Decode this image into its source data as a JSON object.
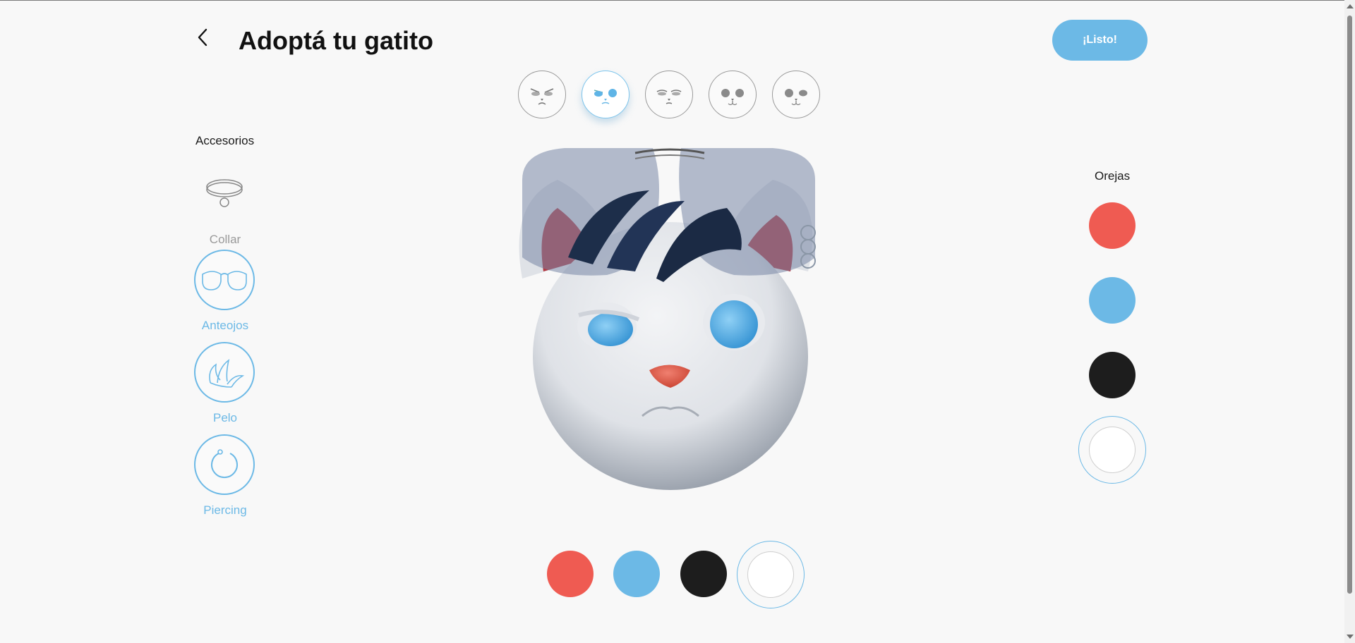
{
  "header": {
    "back_icon": "chevron-left-icon",
    "title": "Adoptá tu gatito",
    "done_label": "¡Listo!"
  },
  "faces": [
    {
      "name": "angry-face",
      "selected": false
    },
    {
      "name": "blue-eyes-face",
      "selected": true
    },
    {
      "name": "sleepy-face",
      "selected": false
    },
    {
      "name": "calm-face",
      "selected": false
    },
    {
      "name": "wink-face",
      "selected": false
    }
  ],
  "accessories": {
    "title": "Accesorios",
    "items": [
      {
        "label": "Collar",
        "icon": "collar-icon",
        "selected": false
      },
      {
        "label": "Anteojos",
        "icon": "glasses-icon",
        "selected": true
      },
      {
        "label": "Pelo",
        "icon": "hair-icon",
        "selected": true
      },
      {
        "label": "Piercing",
        "icon": "piercing-icon",
        "selected": true
      }
    ]
  },
  "ears": {
    "title": "Orejas",
    "swatches": [
      {
        "name": "red",
        "color": "#ef5b52"
      },
      {
        "name": "blue",
        "color": "#6cb9e6"
      },
      {
        "name": "black",
        "color": "#1d1d1d"
      },
      {
        "name": "white",
        "color": "#ffffff",
        "selected": true
      }
    ]
  },
  "body_colors": {
    "swatches": [
      {
        "name": "red",
        "color": "#ef5b52"
      },
      {
        "name": "blue",
        "color": "#6cb9e6"
      },
      {
        "name": "black",
        "color": "#1d1d1d"
      },
      {
        "name": "white",
        "color": "#ffffff",
        "selected": true
      }
    ]
  },
  "colors": {
    "accent": "#6cb9e6",
    "background": "#f8f8f8"
  }
}
